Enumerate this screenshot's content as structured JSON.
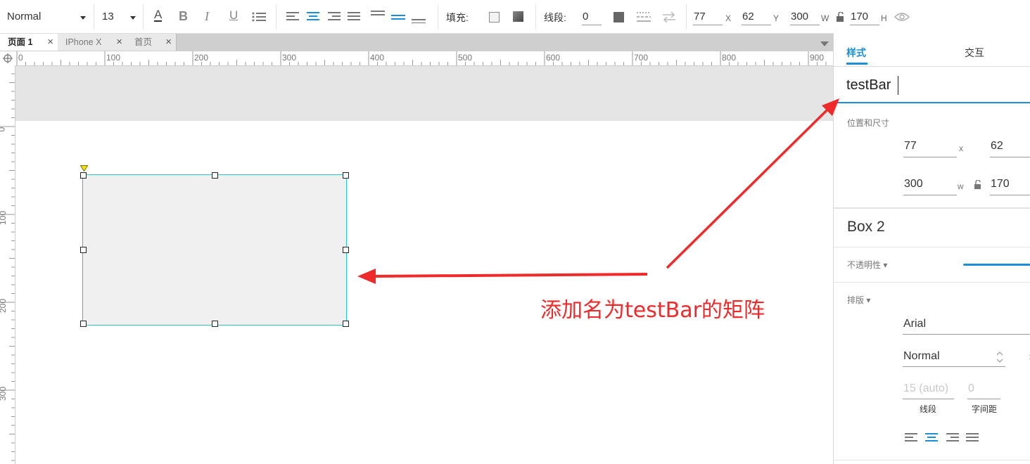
{
  "toolbar": {
    "font_style": "Normal",
    "font_size": "13",
    "fill_label": "填充:",
    "stroke_label": "线段:",
    "stroke_value": "0",
    "x_value": "77",
    "x_label": "X",
    "y_value": "62",
    "y_label": "Y",
    "w_value": "300",
    "w_label": "W",
    "h_value": "170",
    "h_label": "H"
  },
  "tabs": [
    {
      "label": "页面 1",
      "active": true
    },
    {
      "label": "IPhone X",
      "active": false
    },
    {
      "label": "首页",
      "active": false
    }
  ],
  "ruler": {
    "h_ticks": [
      "0",
      "100",
      "200",
      "300",
      "400",
      "500",
      "600",
      "700",
      "800",
      "900"
    ],
    "v_ticks": [
      "0",
      "100",
      "200",
      "300"
    ]
  },
  "panel": {
    "tab_style": "样式",
    "tab_interact": "交互",
    "name_value": "testBar",
    "pos_size_label": "位置和尺寸",
    "x_value": "77",
    "x_label": "x",
    "y_value": "62",
    "w_value": "300",
    "w_label": "w",
    "h_value": "170",
    "shape_name": "Box 2",
    "opacity_label": "不透明性 ▾",
    "typography_label": "排版 ▾",
    "font_family": "Arial",
    "font_weight": "Normal",
    "line_height_placeholder": "15 (auto)",
    "line_height_label": "线段",
    "letter_spacing_value": "0",
    "letter_spacing_label": "字间距"
  },
  "annotation": {
    "text": "添加名为testBar的矩阵",
    "color": "#f02a2a"
  },
  "colors": {
    "accent": "#1a8fd8",
    "selection": "#2bc4c4",
    "shape_fill": "#f0f0f0"
  }
}
